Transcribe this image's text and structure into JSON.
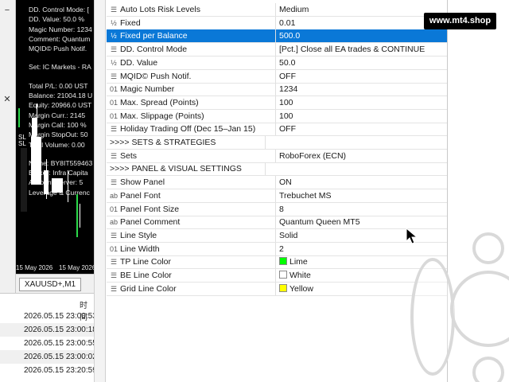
{
  "chart": {
    "info_lines": [
      "DD. Control Mode: [",
      "DD. Value: 50.0 %",
      "Magic Number: 1234",
      "Comment: Quantum",
      "MQID© Push Notif.",
      "",
      "Set: IC Markets - RA",
      "",
      "Total P/L: 0.00 UST",
      "Balance: 21004.18 U",
      "Equity: 20966.0 UST",
      "Margin Curr.: 2145",
      "Margin Call: 100 %",
      "Margin StopOut: 50",
      "Total Volume: 0.00",
      "",
      "Name: BY8IT559463",
      "Broker: Infra Capita",
      "Account Server: 5",
      "Leverage & Currenc"
    ],
    "sl_label": "SL",
    "date_left": "15 May 2026",
    "date_right": "15 May 2026",
    "tab_label": "XAUUSD+,M1"
  },
  "left_marks": [
    "−",
    "✕"
  ],
  "log": {
    "header": "时间",
    "rows": [
      "2026.05.15 23:00:53",
      "2026.05.15 23:00:18",
      "2026.05.15 23:00:55",
      "2026.05.15 23:00:02",
      "2026.05.15 23:20:59"
    ]
  },
  "watermark": "www.mt4.shop",
  "properties": [
    {
      "icon": "list",
      "name": "Auto Lots Risk Levels",
      "value": "Medium"
    },
    {
      "icon": "half",
      "name": "Fixed",
      "value": "0.01"
    },
    {
      "icon": "half",
      "name": "Fixed per Balance",
      "value": "500.0",
      "selected": true
    },
    {
      "icon": "list",
      "name": "DD. Control Mode",
      "value": "[Pct.] Close all EA trades & CONTINUE"
    },
    {
      "icon": "half",
      "name": "DD. Value",
      "value": "50.0"
    },
    {
      "icon": "list",
      "name": "MQID© Push Notif.",
      "value": "OFF"
    },
    {
      "icon": "num",
      "name": "Magic Number",
      "value": "1234"
    },
    {
      "icon": "num",
      "name": "Max. Spread (Points)",
      "value": "100"
    },
    {
      "icon": "num",
      "name": "Max. Slippage (Points)",
      "value": "100"
    },
    {
      "icon": "list",
      "name": "Holiday Trading Off (Dec 15–Jan 15)",
      "value": "OFF"
    },
    {
      "icon": "none",
      "name": ">>>> SETS & STRATEGIES",
      "value": "",
      "section": true
    },
    {
      "icon": "list",
      "name": "Sets",
      "value": "RoboForex (ECN)"
    },
    {
      "icon": "none",
      "name": ">>>> PANEL & VISUAL SETTINGS",
      "value": "",
      "section": true
    },
    {
      "icon": "list",
      "name": "Show Panel",
      "value": "ON"
    },
    {
      "icon": "ab",
      "name": "Panel Font",
      "value": "Trebuchet MS"
    },
    {
      "icon": "num",
      "name": "Panel Font Size",
      "value": "8"
    },
    {
      "icon": "ab",
      "name": "Panel Comment",
      "value": "Quantum Queen MT5"
    },
    {
      "icon": "list",
      "name": "Line Style",
      "value": "Solid"
    },
    {
      "icon": "num",
      "name": "Line Width",
      "value": "2"
    },
    {
      "icon": "list",
      "name": "TP Line Color",
      "value": "Lime",
      "swatch": "#00ff00"
    },
    {
      "icon": "list",
      "name": "BE Line Color",
      "value": "White",
      "swatch": "#ffffff"
    },
    {
      "icon": "list",
      "name": "Grid Line Color",
      "value": "Yellow",
      "swatch": "#ffff00"
    }
  ],
  "icons": {
    "list": "☰",
    "half": "½",
    "num": "01",
    "ab": "ab",
    "none": ""
  },
  "colors": {
    "selection": "#0a78d7",
    "accent_green": "#2bd94a"
  }
}
